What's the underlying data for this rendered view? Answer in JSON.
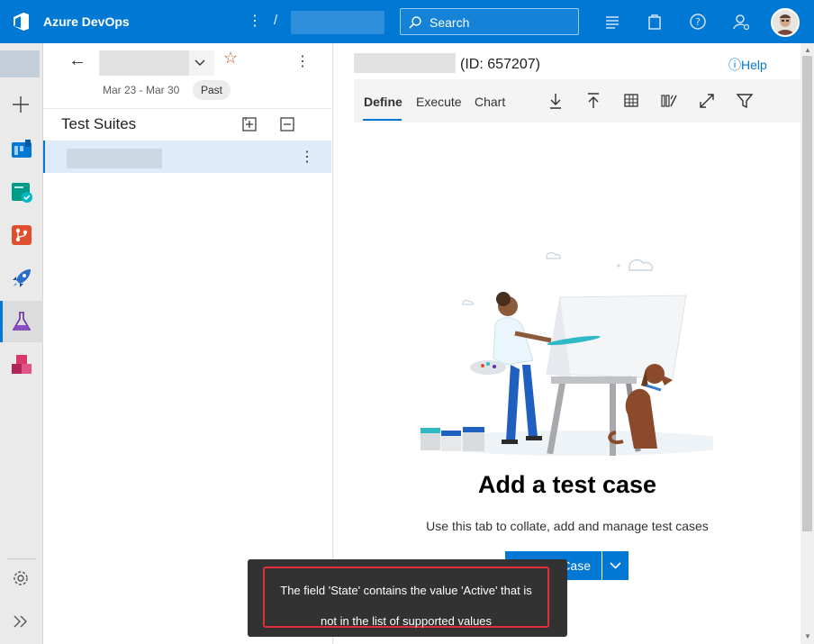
{
  "app": {
    "brand": "Azure DevOps"
  },
  "header": {
    "separator": "/",
    "search_placeholder": "Search",
    "icons": [
      "more-vertical-icon",
      "work-items-list-icon",
      "marketplace-bag-icon",
      "help-icon",
      "user-settings-icon"
    ]
  },
  "rail": {
    "items": [
      "add-icon",
      "boards-icon",
      "test-plans-check-icon",
      "repos-icon",
      "pipelines-icon",
      "test-plans-icon",
      "artifacts-icon"
    ],
    "active": "test-plans-icon",
    "bottom": [
      "settings-gear-icon",
      "expand-chevrons-icon"
    ]
  },
  "plan_panel": {
    "dates": "Mar 23 - Mar 30",
    "badge": "Past",
    "suites_title": "Test Suites"
  },
  "main": {
    "id_label": "(ID: 657207)",
    "help": "ⓘHelp",
    "tabs": [
      "Define",
      "Execute",
      "Chart"
    ],
    "active_tab": "Define",
    "toolbar_icons": [
      "download-icon",
      "upload-icon",
      "grid-icon",
      "column-options-icon",
      "fullscreen-icon",
      "filter-icon"
    ],
    "empty_title": "Add a test case",
    "empty_subtitle": "Use this tab to collate, add and manage test cases",
    "button_label": "Case"
  },
  "toast": {
    "line1": "The field 'State' contains the value 'Active' that is",
    "line2": "not in the list of supported values"
  },
  "colors": {
    "accent": "#0078d4",
    "toast_bg": "#323232",
    "highlight": "#e02f3a"
  }
}
